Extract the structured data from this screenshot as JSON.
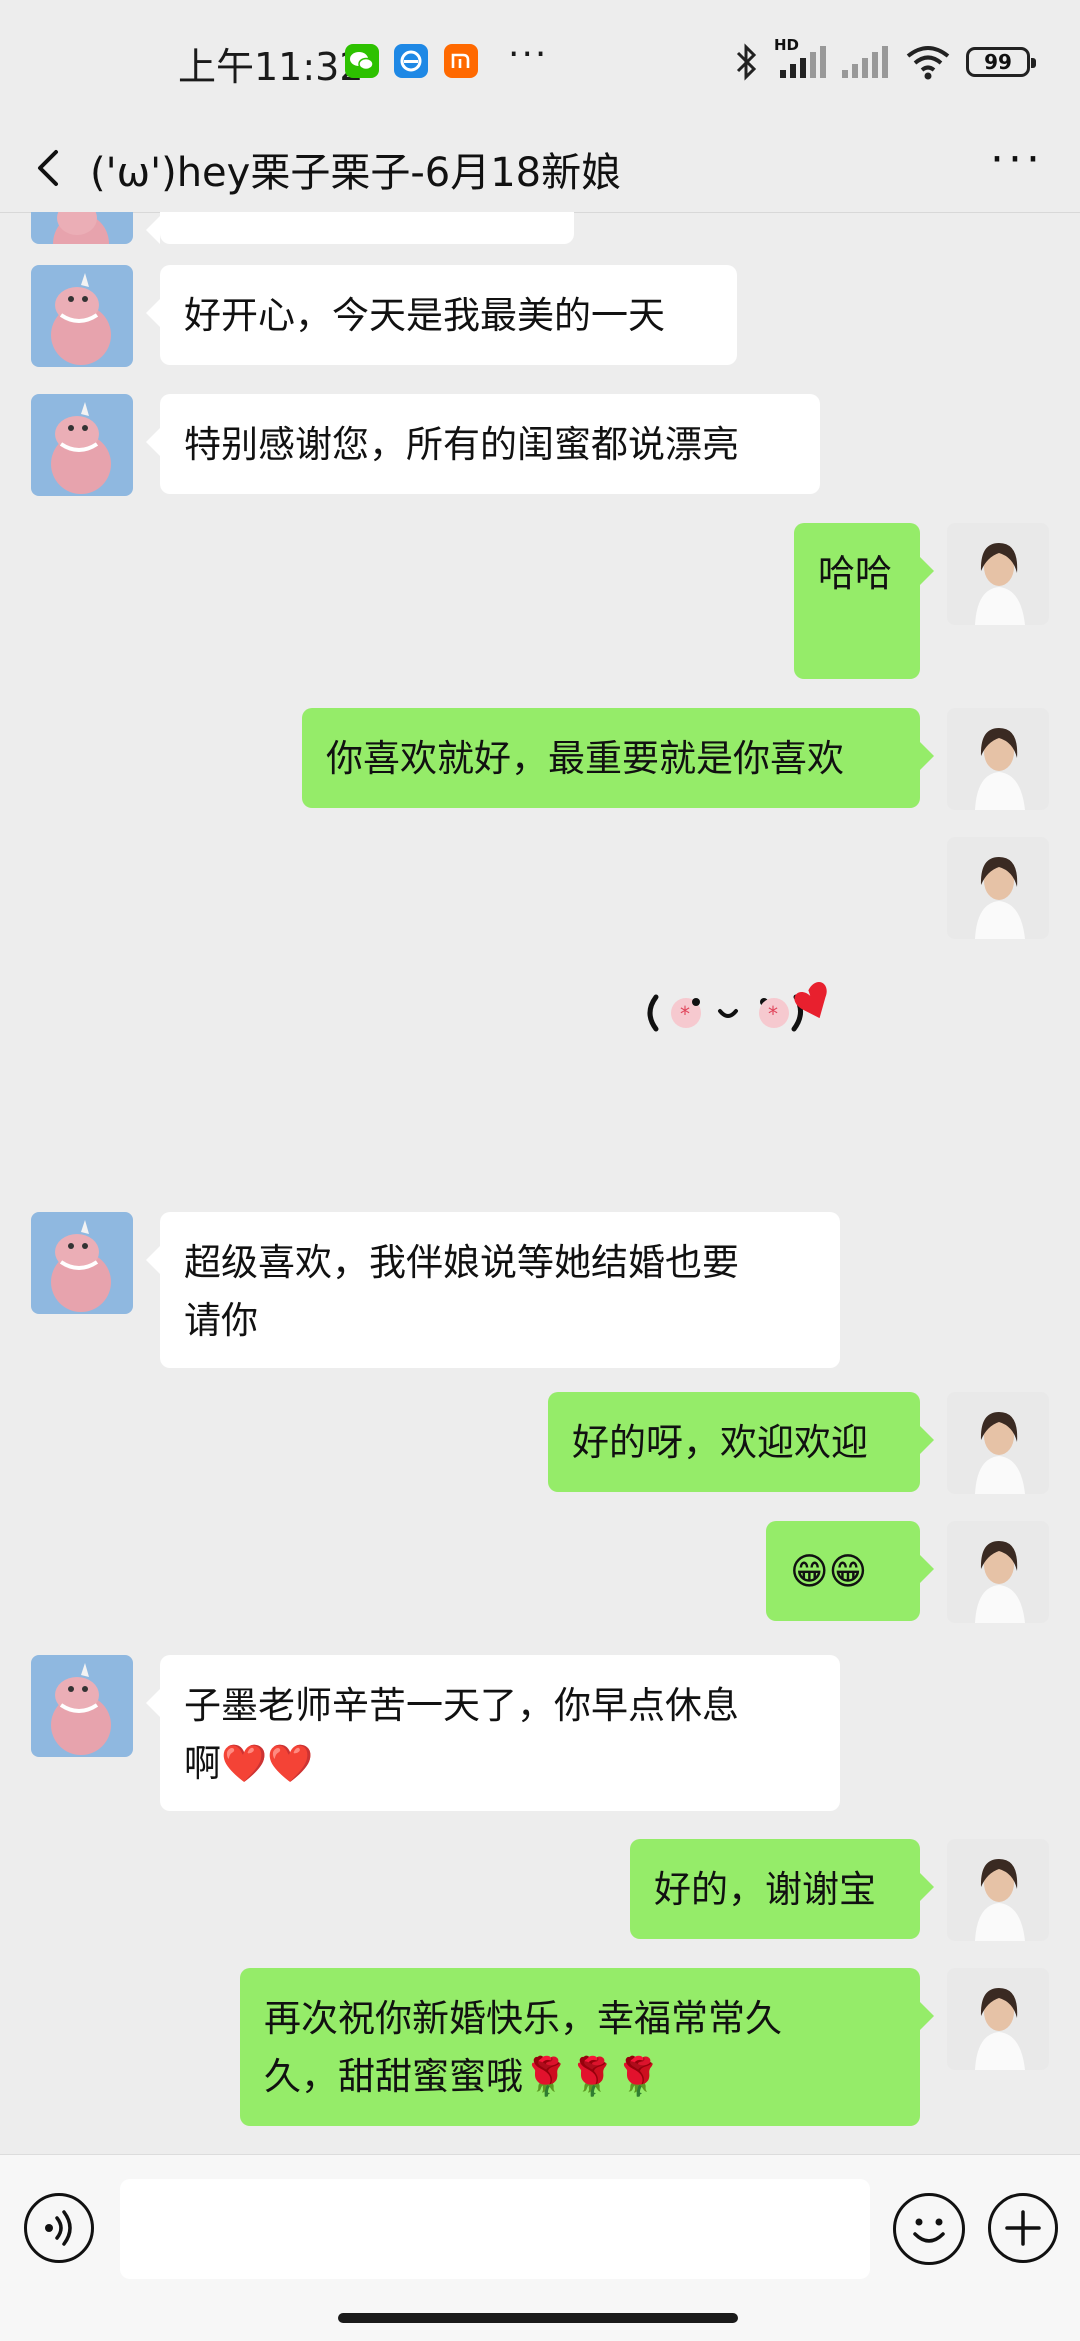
{
  "status_bar": {
    "time": "上午11:32",
    "more": "···",
    "network_badge": "HD",
    "battery": "99"
  },
  "header": {
    "title": "('ω')hey栗子栗子-6月18新娘",
    "more": "···"
  },
  "messages": [
    {
      "from": "them",
      "text": "好开心，今天是我最美的一天"
    },
    {
      "from": "them",
      "text": "特别感谢您，所有的闺蜜都说漂亮"
    },
    {
      "from": "me",
      "text": "哈哈"
    },
    {
      "from": "me",
      "text": "你喜欢就好，最重要就是你喜欢"
    },
    {
      "from": "me",
      "type": "sticker",
      "text": ""
    },
    {
      "from": "them",
      "line1": "超级喜欢，我伴娘说等她结婚也要",
      "line2": "请你"
    },
    {
      "from": "me",
      "text": "好的呀，欢迎欢迎"
    },
    {
      "from": "me",
      "text": "😁😁"
    },
    {
      "from": "them",
      "line1": "子墨老师辛苦一天了，你早点休息",
      "line2": "啊❤️❤️"
    },
    {
      "from": "me",
      "text": "好的，谢谢宝"
    },
    {
      "from": "me",
      "line1": "再次祝你新婚快乐，幸福常常久",
      "line2": "久，甜甜蜜蜜哦🌹🌹🌹"
    }
  ],
  "input_bar": {
    "placeholder": ""
  },
  "colors": {
    "background": "#ededed",
    "outgoing_bubble": "#95ec69",
    "incoming_bubble": "#ffffff"
  },
  "icons": [
    "back-arrow-icon",
    "more-icon",
    "voice-icon",
    "emoji-icon",
    "plus-icon",
    "bluetooth-icon",
    "wifi-icon",
    "signal-icon",
    "battery-icon"
  ]
}
